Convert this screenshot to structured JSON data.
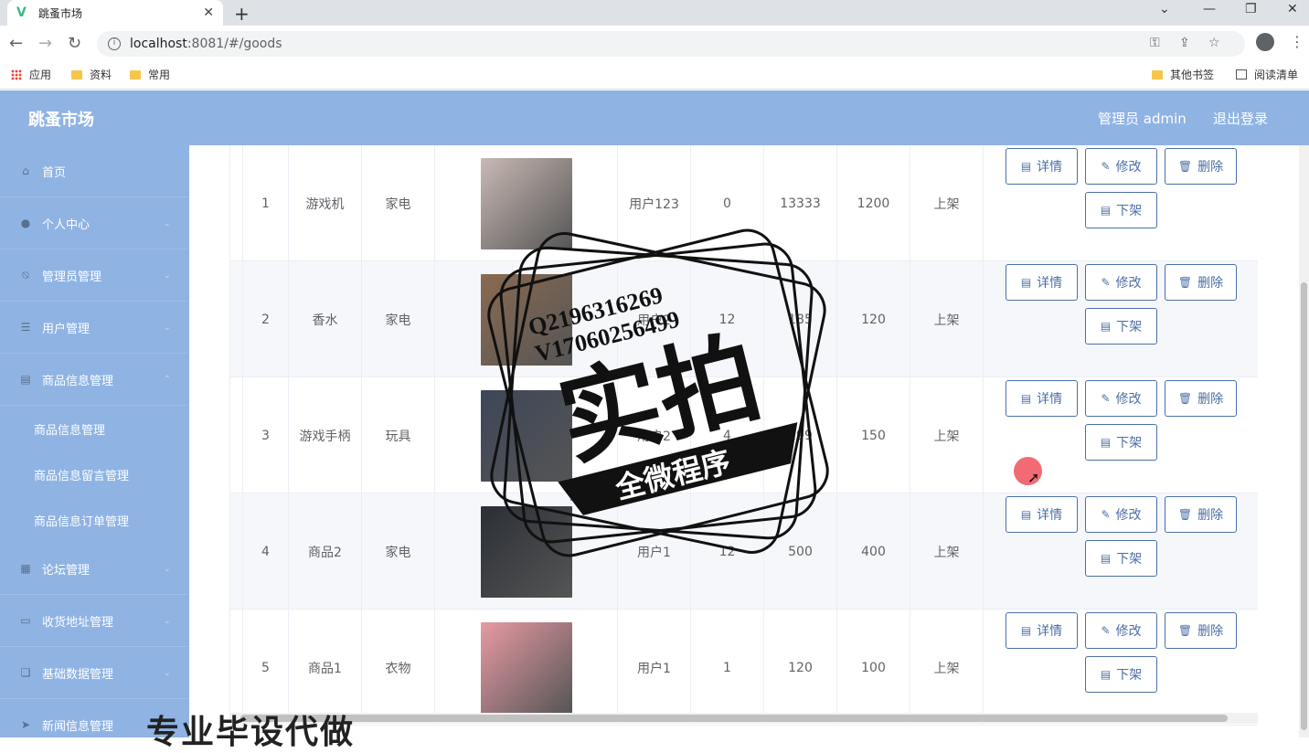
{
  "browser": {
    "tab_title": "跳蚤市场",
    "tab_close": "✕",
    "new_tab": "+",
    "url_host": "localhost",
    "url_rest": ":8081/#/goods",
    "bookmarks": [
      "应用",
      "资料",
      "常用"
    ],
    "bookmarks_right": [
      "其他书签",
      "阅读清单"
    ]
  },
  "header": {
    "brand": "跳蚤市场",
    "admin": "管理员 admin",
    "logout": "退出登录"
  },
  "sidebar": {
    "items": [
      {
        "label": "首页",
        "icon": "home-icon"
      },
      {
        "label": "个人中心",
        "icon": "user-icon"
      },
      {
        "label": "管理员管理",
        "icon": "bell-off-icon"
      },
      {
        "label": "用户管理",
        "icon": "menu-icon"
      },
      {
        "label": "商品信息管理",
        "icon": "clipboard-icon"
      }
    ],
    "sub_items": [
      "商品信息管理",
      "商品信息留言管理",
      "商品信息订单管理"
    ],
    "items_after": [
      {
        "label": "论坛管理",
        "icon": "chart-icon"
      },
      {
        "label": "收货地址管理",
        "icon": "card-icon"
      },
      {
        "label": "基础数据管理",
        "icon": "copy-icon"
      },
      {
        "label": "新闻信息管理",
        "icon": "send-icon"
      }
    ]
  },
  "table": {
    "rows": [
      {
        "id": "1",
        "name": "游戏机",
        "category": "家电",
        "user": "用户123",
        "a": "0",
        "b": "13333",
        "price": "1200",
        "status": "上架",
        "img_color": "#c9b9b3"
      },
      {
        "id": "2",
        "name": "香水",
        "category": "家电",
        "user": "用户2",
        "a": "12",
        "b": "185",
        "price": "120",
        "status": "上架",
        "img_color": "#8a6a52"
      },
      {
        "id": "3",
        "name": "游戏手柄",
        "category": "玩具",
        "user": "用户2",
        "a": "4",
        "b": "199",
        "price": "150",
        "status": "上架",
        "img_color": "#3d4658"
      },
      {
        "id": "4",
        "name": "商品2",
        "category": "家电",
        "user": "用户1",
        "a": "12",
        "b": "500",
        "price": "400",
        "status": "上架",
        "img_color": "#2b2f36"
      },
      {
        "id": "5",
        "name": "商品1",
        "category": "衣物",
        "user": "用户1",
        "a": "1",
        "b": "120",
        "price": "100",
        "status": "上架",
        "img_color": "#e79aa3"
      }
    ],
    "buttons": {
      "detail": "详情",
      "edit": "修改",
      "delete": "删除",
      "offshelf": "下架"
    }
  },
  "watermark": {
    "qq": "Q2196316269",
    "v": "V17060256499",
    "big": "实拍",
    "ribbon": "全微程序",
    "banner": "专业毕设代做"
  }
}
